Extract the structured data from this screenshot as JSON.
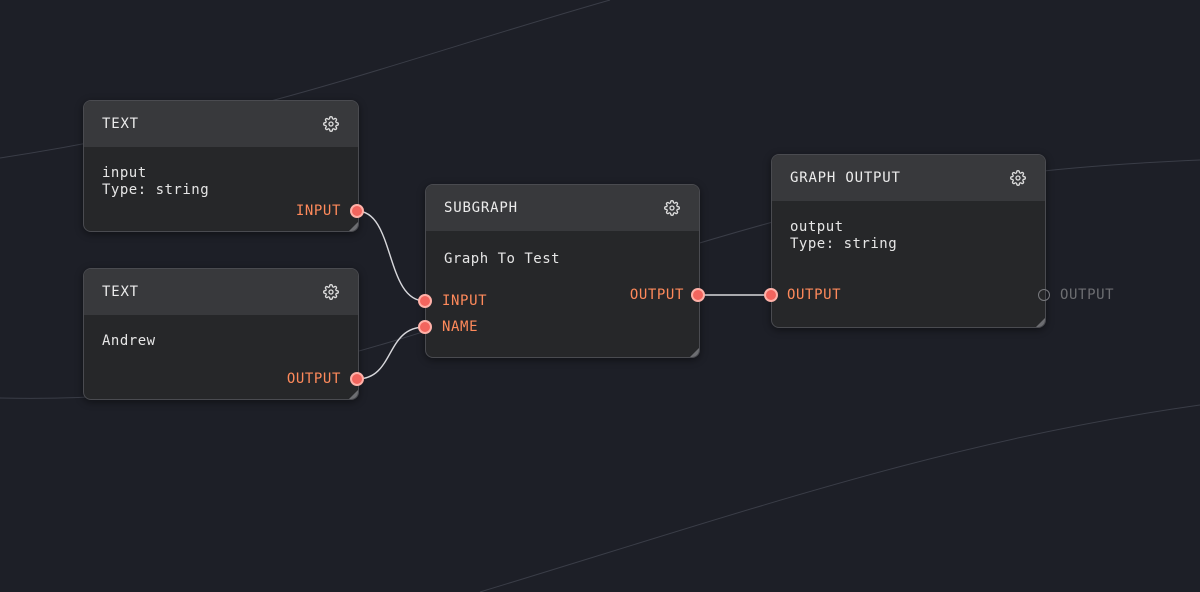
{
  "nodes": {
    "text1": {
      "title": "TEXT",
      "lines": [
        "input",
        "Type: string"
      ],
      "output_port": "INPUT"
    },
    "text2": {
      "title": "TEXT",
      "lines": [
        "Andrew"
      ],
      "output_port": "OUTPUT"
    },
    "subgraph": {
      "title": "SUBGRAPH",
      "body": "Graph To Test",
      "input_ports": [
        "INPUT",
        "NAME"
      ],
      "output_port": "OUTPUT"
    },
    "graph_output": {
      "title": "GRAPH OUTPUT",
      "lines": [
        "output",
        "Type: string"
      ],
      "input_port": "OUTPUT",
      "external_output_port": "OUTPUT"
    }
  },
  "icons": {
    "settings": "gear-icon"
  },
  "colors": {
    "background": "#1d1f27",
    "node_body": "#262729",
    "node_header": "#38393c",
    "port_label": "#ff8a5b",
    "port_fill": "#f2655e",
    "wire": "#d8d8dc",
    "inactive_label": "#6d6e72"
  }
}
